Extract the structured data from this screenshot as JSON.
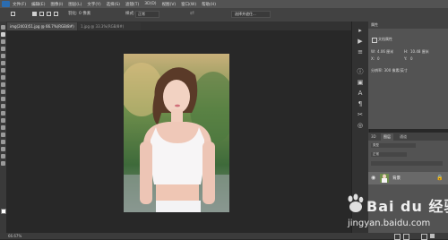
{
  "menu": {
    "items": [
      "文件(F)",
      "编辑(E)",
      "图像(I)",
      "图层(L)",
      "文字(Y)",
      "选择(S)",
      "滤镜(T)",
      "3D(D)",
      "视图(V)",
      "窗口(W)",
      "帮助(H)"
    ]
  },
  "options": {
    "feather_label": "羽化:",
    "feather_value": "0 像素",
    "style_label": "样式:",
    "style_value": "正常",
    "select_mask_button": "选择并遮住..."
  },
  "tabs": [
    {
      "label": "img(2403)51.jpg @ 66.7%(RGB/8#)"
    },
    {
      "label": "1.jpg @ 33.3%(RGB/8#)"
    }
  ],
  "properties": {
    "title": "属性",
    "doc_label": "文档属性",
    "w_label": "W:",
    "w_value": "4.06 厘米",
    "h_label": "H:",
    "h_value": "10.48 厘米",
    "x_label": "X:",
    "x_value": "0",
    "y_label": "Y:",
    "y_value": "0",
    "resolution": "分辨率: 300 像素/英寸"
  },
  "layers": {
    "tabs": [
      "3D",
      "图层",
      "通道"
    ],
    "kind_label": "类型",
    "mode_value": "正常",
    "layer_name": "背景"
  },
  "status": {
    "zoom": "66.67%"
  },
  "watermark": {
    "brand": "Bai du 经验",
    "url": "jingyan.baidu.com"
  }
}
